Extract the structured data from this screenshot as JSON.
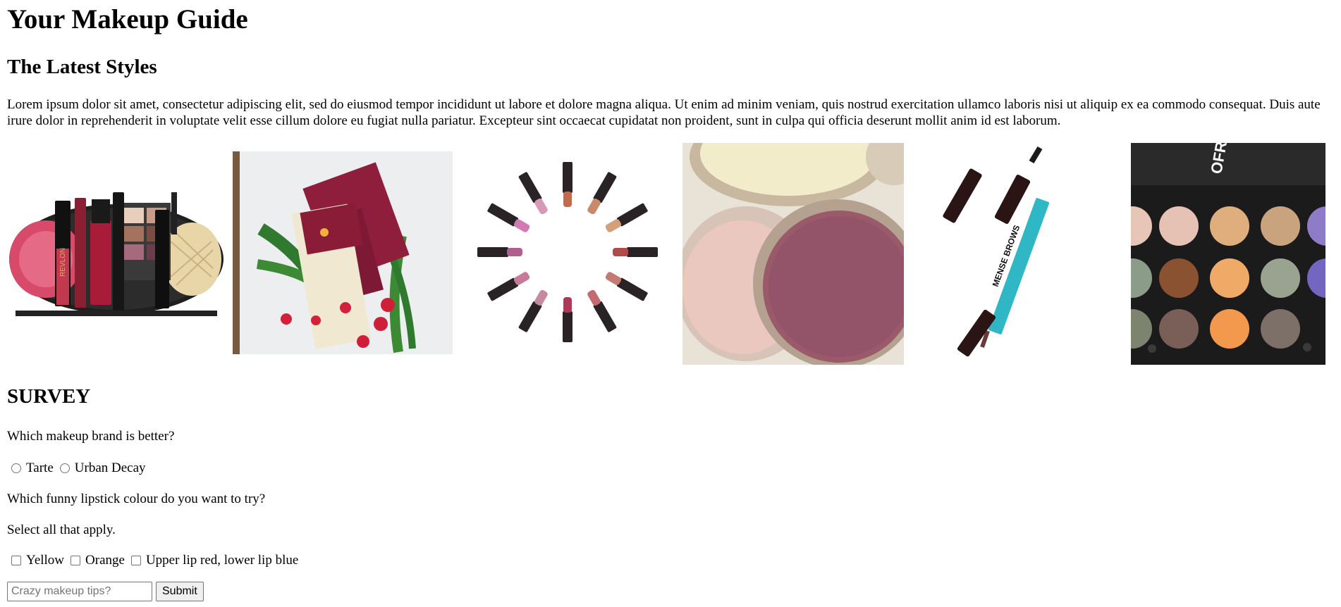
{
  "page": {
    "title": "Your Makeup Guide",
    "section_heading": "The Latest Styles",
    "intro_text": "Lorem ipsum dolor sit amet, consectetur adipiscing elit, sed do eiusmod tempor incididunt ut labore et dolore magna aliqua. Ut enim ad minim veniam, quis nostrud exercitation ullamco laboris nisi ut aliquip ex ea commodo consequat. Duis aute irure dolor in reprehenderit in voluptate velit esse cillum dolore eu fugiat nulla pariatur. Excepteur sint occaecat cupidatat non proident, sunt in culpa qui officia deserunt mollit anim id est laborum."
  },
  "gallery": {
    "images": [
      {
        "icon": "makeup-kit-image",
        "text": "REVLON"
      },
      {
        "icon": "cosmetic-pouch-image"
      },
      {
        "icon": "lipstick-circle-image"
      },
      {
        "icon": "pressed-powder-image"
      },
      {
        "icon": "eyeliner-pencil-image",
        "text": "MENSE BROWS"
      },
      {
        "icon": "eyeshadow-palette-image",
        "text": "OFRA"
      }
    ]
  },
  "survey": {
    "heading": "SURVEY",
    "brand_question": "Which makeup brand is better?",
    "brand_options": [
      "Tarte",
      "Urban Decay"
    ],
    "lipstick_question": "Which funny lipstick colour do you want to try?",
    "lipstick_hint": "Select all that apply.",
    "lipstick_options": [
      "Yellow",
      "Orange",
      "Upper lip red, lower lip blue"
    ],
    "tips_placeholder": "Crazy makeup tips?",
    "submit_label": "Submit"
  },
  "colors": {
    "text": "#000000",
    "background": "#ffffff",
    "control_border": "#767676",
    "button_bg": "#efefef"
  }
}
